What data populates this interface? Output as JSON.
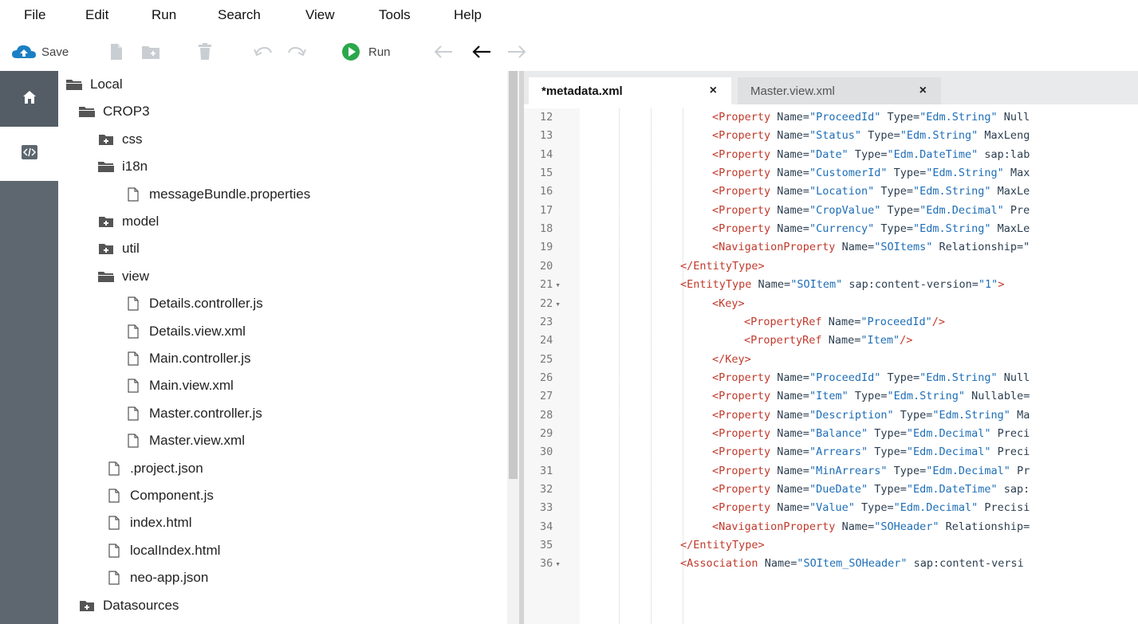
{
  "menu": [
    "File",
    "Edit",
    "Run",
    "Search",
    "View",
    "Tools",
    "Help"
  ],
  "toolbar": {
    "save_label": "Save",
    "run_label": "Run"
  },
  "colors": {
    "rail": "#5e6770",
    "run_green": "#2aa84a",
    "save_blue": "#1b7fc4",
    "tag_red": "#c0392b",
    "value_blue": "#1e6eb7"
  },
  "tree": [
    {
      "label": "Local",
      "type": "folder-open",
      "depth": 0
    },
    {
      "label": "CROP3",
      "type": "folder-open",
      "depth": 1
    },
    {
      "label": "css",
      "type": "folder-closed",
      "depth": 2
    },
    {
      "label": "i18n",
      "type": "folder-open",
      "depth": 2
    },
    {
      "label": "messageBundle.properties",
      "type": "file",
      "depth": 3
    },
    {
      "label": "model",
      "type": "folder-closed",
      "depth": 2
    },
    {
      "label": "util",
      "type": "folder-closed",
      "depth": 2
    },
    {
      "label": "view",
      "type": "folder-open",
      "depth": 2
    },
    {
      "label": "Details.controller.js",
      "type": "file",
      "depth": 3
    },
    {
      "label": "Details.view.xml",
      "type": "file",
      "depth": 3
    },
    {
      "label": "Main.controller.js",
      "type": "file",
      "depth": 3
    },
    {
      "label": "Main.view.xml",
      "type": "file",
      "depth": 3
    },
    {
      "label": "Master.controller.js",
      "type": "file",
      "depth": 3
    },
    {
      "label": "Master.view.xml",
      "type": "file",
      "depth": 3
    },
    {
      "label": ".project.json",
      "type": "file",
      "depth": 2
    },
    {
      "label": "Component.js",
      "type": "file",
      "depth": 2
    },
    {
      "label": "index.html",
      "type": "file",
      "depth": 2
    },
    {
      "label": "localIndex.html",
      "type": "file",
      "depth": 2
    },
    {
      "label": "neo-app.json",
      "type": "file",
      "depth": 2
    },
    {
      "label": "Datasources",
      "type": "folder-closed",
      "depth": 1
    }
  ],
  "tabs": [
    {
      "label": "*metadata.xml",
      "close": "×"
    },
    {
      "label": "Master.view.xml",
      "close": "×"
    }
  ],
  "code_lines": [
    {
      "n": "12",
      "fold": false,
      "indent": 4,
      "tag": "Property",
      "rest": [
        [
          "Name",
          "ProceedId"
        ],
        [
          "Type",
          "Edm.String"
        ]
      ],
      "tail": " Null"
    },
    {
      "n": "13",
      "fold": false,
      "indent": 4,
      "tag": "Property",
      "rest": [
        [
          "Name",
          "Status"
        ],
        [
          "Type",
          "Edm.String"
        ]
      ],
      "tail": " MaxLeng"
    },
    {
      "n": "14",
      "fold": false,
      "indent": 4,
      "tag": "Property",
      "rest": [
        [
          "Name",
          "Date"
        ],
        [
          "Type",
          "Edm.DateTime"
        ]
      ],
      "tail": " sap:lab"
    },
    {
      "n": "15",
      "fold": false,
      "indent": 4,
      "tag": "Property",
      "rest": [
        [
          "Name",
          "CustomerId"
        ],
        [
          "Type",
          "Edm.String"
        ]
      ],
      "tail": " Max"
    },
    {
      "n": "16",
      "fold": false,
      "indent": 4,
      "tag": "Property",
      "rest": [
        [
          "Name",
          "Location"
        ],
        [
          "Type",
          "Edm.String"
        ]
      ],
      "tail": " MaxLe"
    },
    {
      "n": "17",
      "fold": false,
      "indent": 4,
      "tag": "Property",
      "rest": [
        [
          "Name",
          "CropValue"
        ],
        [
          "Type",
          "Edm.Decimal"
        ]
      ],
      "tail": " Pre"
    },
    {
      "n": "18",
      "fold": false,
      "indent": 4,
      "tag": "Property",
      "rest": [
        [
          "Name",
          "Currency"
        ],
        [
          "Type",
          "Edm.String"
        ]
      ],
      "tail": " MaxLe"
    },
    {
      "n": "19",
      "fold": false,
      "indent": 4,
      "tag": "NavigationProperty",
      "rest": [
        [
          "Name",
          "SOItems"
        ]
      ],
      "tail": " Relationship=\""
    },
    {
      "n": "20",
      "fold": false,
      "indent": 3,
      "close": "EntityType"
    },
    {
      "n": "21",
      "fold": true,
      "indent": 3,
      "tag": "EntityType",
      "rest": [
        [
          "Name",
          "SOItem"
        ],
        [
          "sap:content-version",
          "1"
        ]
      ],
      "end": ">"
    },
    {
      "n": "22",
      "fold": true,
      "indent": 4,
      "tag": "Key",
      "rest": [],
      "end": ">"
    },
    {
      "n": "23",
      "fold": false,
      "indent": 5,
      "tag": "PropertyRef",
      "rest": [
        [
          "Name",
          "ProceedId"
        ]
      ],
      "end": "/>"
    },
    {
      "n": "24",
      "fold": false,
      "indent": 5,
      "tag": "PropertyRef",
      "rest": [
        [
          "Name",
          "Item"
        ]
      ],
      "end": "/>"
    },
    {
      "n": "25",
      "fold": false,
      "indent": 4,
      "close": "Key"
    },
    {
      "n": "26",
      "fold": false,
      "indent": 4,
      "tag": "Property",
      "rest": [
        [
          "Name",
          "ProceedId"
        ],
        [
          "Type",
          "Edm.String"
        ]
      ],
      "tail": " Null"
    },
    {
      "n": "27",
      "fold": false,
      "indent": 4,
      "tag": "Property",
      "rest": [
        [
          "Name",
          "Item"
        ],
        [
          "Type",
          "Edm.String"
        ]
      ],
      "tail": " Nullable="
    },
    {
      "n": "28",
      "fold": false,
      "indent": 4,
      "tag": "Property",
      "rest": [
        [
          "Name",
          "Description"
        ],
        [
          "Type",
          "Edm.String"
        ]
      ],
      "tail": " Ma"
    },
    {
      "n": "29",
      "fold": false,
      "indent": 4,
      "tag": "Property",
      "rest": [
        [
          "Name",
          "Balance"
        ],
        [
          "Type",
          "Edm.Decimal"
        ]
      ],
      "tail": " Preci"
    },
    {
      "n": "30",
      "fold": false,
      "indent": 4,
      "tag": "Property",
      "rest": [
        [
          "Name",
          "Arrears"
        ],
        [
          "Type",
          "Edm.Decimal"
        ]
      ],
      "tail": " Preci"
    },
    {
      "n": "31",
      "fold": false,
      "indent": 4,
      "tag": "Property",
      "rest": [
        [
          "Name",
          "MinArrears"
        ],
        [
          "Type",
          "Edm.Decimal"
        ]
      ],
      "tail": " Pr"
    },
    {
      "n": "32",
      "fold": false,
      "indent": 4,
      "tag": "Property",
      "rest": [
        [
          "Name",
          "DueDate"
        ],
        [
          "Type",
          "Edm.DateTime"
        ]
      ],
      "tail": " sap:"
    },
    {
      "n": "33",
      "fold": false,
      "indent": 4,
      "tag": "Property",
      "rest": [
        [
          "Name",
          "Value"
        ],
        [
          "Type",
          "Edm.Decimal"
        ]
      ],
      "tail": " Precisi"
    },
    {
      "n": "34",
      "fold": false,
      "indent": 4,
      "tag": "NavigationProperty",
      "rest": [
        [
          "Name",
          "SOHeader"
        ]
      ],
      "tail": " Relationship="
    },
    {
      "n": "35",
      "fold": false,
      "indent": 3,
      "close": "EntityType"
    },
    {
      "n": "36",
      "fold": true,
      "indent": 3,
      "tag": "Association",
      "rest": [
        [
          "Name",
          "SOItem_SOHeader"
        ]
      ],
      "tail": " sap:content-versi"
    }
  ]
}
